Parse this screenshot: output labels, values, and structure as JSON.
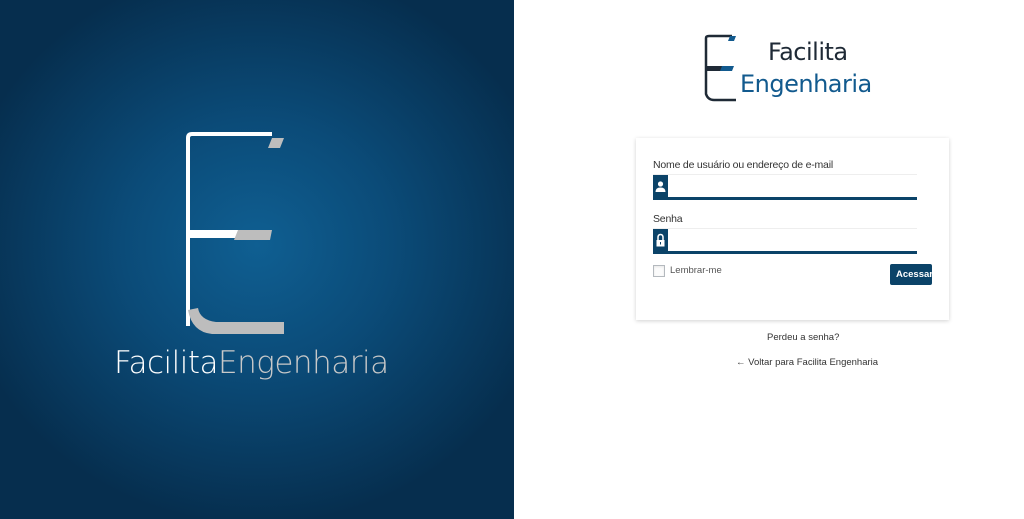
{
  "brand": {
    "left_word1": "Facilita",
    "left_word2": "Engenharia",
    "logo_word1": "Facilita",
    "logo_word2": "Engenharia"
  },
  "login": {
    "username_label": "Nome de usuário ou endereço de e-mail",
    "username_value": "",
    "password_label": "Senha",
    "password_value": "",
    "remember_label": "Lembrar-me",
    "remember_checked": false,
    "submit_label": "Acessar"
  },
  "links": {
    "lost_password": "Perdeu a senha?",
    "back_arrow": "←",
    "back_to_site": "Voltar para Facilita Engenharia"
  },
  "icons": {
    "user_field": "user-icon",
    "password_field": "lock-icon"
  },
  "colors": {
    "primary": "#0b4368",
    "left_panel_dark": "#062e4e",
    "left_panel_light": "#0f5f92",
    "logo_gray": "#bdbdbd",
    "brand_blue": "#125a8e"
  }
}
